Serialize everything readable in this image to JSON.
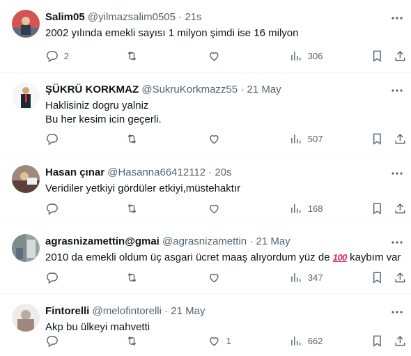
{
  "tweets": [
    {
      "name": "Salim05",
      "handle": "@yilmazsalim0505",
      "sep": "·",
      "time": "21s",
      "lines": [
        "2002 yılında emekli sayısı 1 milyon şimdi ise 16 milyon"
      ],
      "replies": "2",
      "retweets": "",
      "likes": "",
      "views": "306",
      "avatar_colors": [
        "#c0392b",
        "#2c3e50"
      ]
    },
    {
      "name": "ŞÜKRÜ KORKMAZ",
      "handle": "@SukruKorkmazz55",
      "sep": "·",
      "time": "21 May",
      "lines": [
        "Haklisiniz dogru yalniz",
        "Bu her kesim icin geçerli."
      ],
      "replies": "",
      "retweets": "",
      "likes": "",
      "views": "507",
      "avatar_colors": [
        "#ffffff",
        "#1c2833"
      ]
    },
    {
      "name": "Hasan çınar",
      "handle": "@Hasanna66412112",
      "sep": "·",
      "time": "20s",
      "lines": [
        "Veridiler yetkiyi gördüler etkiyi,müstehaktır"
      ],
      "replies": "",
      "retweets": "",
      "likes": "",
      "views": "168",
      "avatar_colors": [
        "#8e6e53",
        "#3e2c23"
      ]
    },
    {
      "name": "agrasnizamettin@gmai",
      "handle": "@agrasnizamettin",
      "sep": "·",
      "time": "21 May",
      "line_before_emoji": "2010 da emekli oldum üç asgari ücret maaş alıyordum yüz de",
      "emoji": "100",
      "line_after_emoji": "kaybım var",
      "replies": "",
      "retweets": "",
      "likes": "",
      "views": "347",
      "avatar_colors": [
        "#7f8c8d",
        "#bdc3c7"
      ]
    },
    {
      "name": "Fintorelli",
      "handle": "@melofintorelli",
      "sep": "·",
      "time": "21 May",
      "lines": [
        "Akp bu ülkeyi mahvetti"
      ],
      "replies": "",
      "retweets": "",
      "likes": "1",
      "views": "662",
      "avatar_colors": [
        "#d7ccc8",
        "#8d6e63"
      ]
    }
  ]
}
